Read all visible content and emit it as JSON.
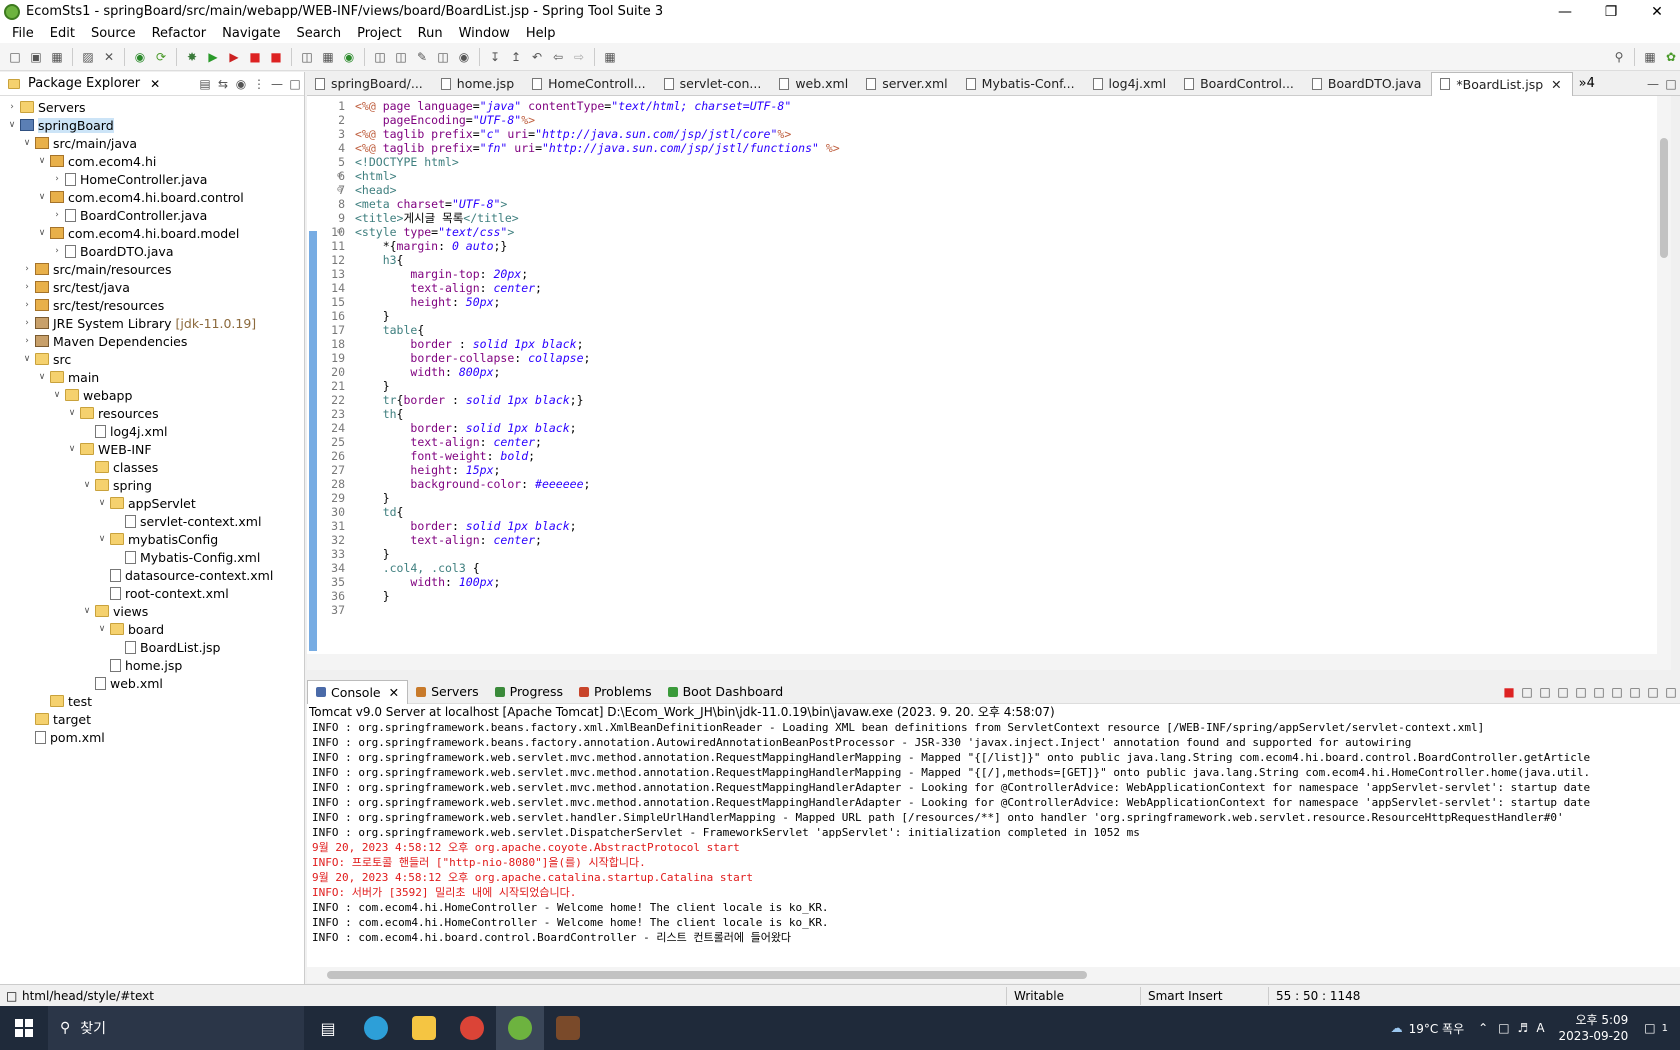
{
  "window": {
    "title": "EcomSts1 - springBoard/src/main/webapp/WEB-INF/views/board/BoardList.jsp - Spring Tool Suite 3"
  },
  "menu": [
    "File",
    "Edit",
    "Source",
    "Refactor",
    "Navigate",
    "Search",
    "Project",
    "Run",
    "Window",
    "Help"
  ],
  "explorer": {
    "title": "Package Explorer",
    "tree": [
      {
        "label": "Servers",
        "depth": 0,
        "twisty": ">",
        "icon": "folder"
      },
      {
        "label": "springBoard",
        "depth": 0,
        "twisty": "v",
        "icon": "proj",
        "selected": true
      },
      {
        "label": "src/main/java",
        "depth": 1,
        "twisty": "v",
        "icon": "pkg"
      },
      {
        "label": "com.ecom4.hi",
        "depth": 2,
        "twisty": "v",
        "icon": "pkg"
      },
      {
        "label": "HomeController.java",
        "depth": 3,
        "twisty": ">",
        "icon": "file"
      },
      {
        "label": "com.ecom4.hi.board.control",
        "depth": 2,
        "twisty": "v",
        "icon": "pkg"
      },
      {
        "label": "BoardController.java",
        "depth": 3,
        "twisty": ">",
        "icon": "file"
      },
      {
        "label": "com.ecom4.hi.board.model",
        "depth": 2,
        "twisty": "v",
        "icon": "pkg"
      },
      {
        "label": "BoardDTO.java",
        "depth": 3,
        "twisty": ">",
        "icon": "file"
      },
      {
        "label": "src/main/resources",
        "depth": 1,
        "twisty": ">",
        "icon": "pkg"
      },
      {
        "label": "src/test/java",
        "depth": 1,
        "twisty": ">",
        "icon": "pkg"
      },
      {
        "label": "src/test/resources",
        "depth": 1,
        "twisty": ">",
        "icon": "pkg"
      },
      {
        "label": "JRE System Library",
        "suffix": "[jdk-11.0.19]",
        "depth": 1,
        "twisty": ">",
        "icon": "lib"
      },
      {
        "label": "Maven Dependencies",
        "depth": 1,
        "twisty": ">",
        "icon": "lib"
      },
      {
        "label": "src",
        "depth": 1,
        "twisty": "v",
        "icon": "folder"
      },
      {
        "label": "main",
        "depth": 2,
        "twisty": "v",
        "icon": "folder"
      },
      {
        "label": "webapp",
        "depth": 3,
        "twisty": "v",
        "icon": "folder"
      },
      {
        "label": "resources",
        "depth": 4,
        "twisty": "v",
        "icon": "folder"
      },
      {
        "label": "log4j.xml",
        "depth": 5,
        "twisty": "",
        "icon": "file"
      },
      {
        "label": "WEB-INF",
        "depth": 4,
        "twisty": "v",
        "icon": "folder"
      },
      {
        "label": "classes",
        "depth": 5,
        "twisty": "",
        "icon": "folder"
      },
      {
        "label": "spring",
        "depth": 5,
        "twisty": "v",
        "icon": "folder"
      },
      {
        "label": "appServlet",
        "depth": 6,
        "twisty": "v",
        "icon": "folder"
      },
      {
        "label": "servlet-context.xml",
        "depth": 7,
        "twisty": "",
        "icon": "file"
      },
      {
        "label": "mybatisConfig",
        "depth": 6,
        "twisty": "v",
        "icon": "folder"
      },
      {
        "label": "Mybatis-Config.xml",
        "depth": 7,
        "twisty": "",
        "icon": "file"
      },
      {
        "label": "datasource-context.xml",
        "depth": 6,
        "twisty": "",
        "icon": "file"
      },
      {
        "label": "root-context.xml",
        "depth": 6,
        "twisty": "",
        "icon": "file"
      },
      {
        "label": "views",
        "depth": 5,
        "twisty": "v",
        "icon": "folder"
      },
      {
        "label": "board",
        "depth": 6,
        "twisty": "v",
        "icon": "folder"
      },
      {
        "label": "BoardList.jsp",
        "depth": 7,
        "twisty": "",
        "icon": "file"
      },
      {
        "label": "home.jsp",
        "depth": 6,
        "twisty": "",
        "icon": "file"
      },
      {
        "label": "web.xml",
        "depth": 5,
        "twisty": "",
        "icon": "file"
      },
      {
        "label": "test",
        "depth": 2,
        "twisty": "",
        "icon": "folder"
      },
      {
        "label": "target",
        "depth": 1,
        "twisty": "",
        "icon": "folder"
      },
      {
        "label": "pom.xml",
        "depth": 1,
        "twisty": "",
        "icon": "file"
      }
    ]
  },
  "editor_tabs": [
    {
      "label": "springBoard/..."
    },
    {
      "label": "home.jsp"
    },
    {
      "label": "HomeControll..."
    },
    {
      "label": "servlet-con..."
    },
    {
      "label": "web.xml"
    },
    {
      "label": "server.xml"
    },
    {
      "label": "Mybatis-Conf..."
    },
    {
      "label": "log4j.xml"
    },
    {
      "label": "BoardControl..."
    },
    {
      "label": "BoardDTO.java"
    },
    {
      "label": "*BoardList.jsp",
      "active": true
    }
  ],
  "overflow_tabs": "»4",
  "code_lines": [
    {
      "n": "1",
      "parts": [
        [
          "jsp",
          "<%@ "
        ],
        [
          "attr",
          "page "
        ],
        [
          "attr",
          "language"
        ],
        [
          "",
          "="
        ],
        [
          "val",
          "\"java\""
        ],
        [
          "",
          ""
        ],
        [
          "attr",
          " contentType"
        ],
        [
          "",
          "="
        ],
        [
          "val",
          "\"text/html; charset=UTF-8\""
        ]
      ]
    },
    {
      "n": "2",
      "parts": [
        [
          "",
          "    "
        ],
        [
          "attr",
          "pageEncoding"
        ],
        [
          "",
          "="
        ],
        [
          "val",
          "\"UTF-8\""
        ],
        [
          "jsp",
          "%>"
        ]
      ]
    },
    {
      "n": "3",
      "parts": [
        [
          "jsp",
          "<%@ "
        ],
        [
          "attr",
          "taglib "
        ],
        [
          "attr",
          "prefix"
        ],
        [
          "",
          "="
        ],
        [
          "val",
          "\"c\""
        ],
        [
          "attr",
          " uri"
        ],
        [
          "",
          "="
        ],
        [
          "val",
          "\"http://java.sun.com/jsp/jstl/core\""
        ],
        [
          "jsp",
          "%>"
        ]
      ]
    },
    {
      "n": "4",
      "parts": [
        [
          "jsp",
          "<%@ "
        ],
        [
          "attr",
          "taglib "
        ],
        [
          "attr",
          "prefix"
        ],
        [
          "",
          "="
        ],
        [
          "val",
          "\"fn\""
        ],
        [
          "attr",
          " uri"
        ],
        [
          "",
          "="
        ],
        [
          "val",
          "\"http://java.sun.com/jsp/jstl/functions\""
        ],
        [
          "jsp",
          " %>"
        ]
      ]
    },
    {
      "n": "5",
      "parts": [
        [
          "tag",
          "<!DOCTYPE html>"
        ]
      ]
    },
    {
      "n": "6",
      "fold": true,
      "parts": [
        [
          "tag",
          "<html>"
        ]
      ]
    },
    {
      "n": "7",
      "fold": true,
      "parts": [
        [
          "tag",
          "<head>"
        ]
      ]
    },
    {
      "n": "8",
      "parts": [
        [
          "tag",
          "<meta "
        ],
        [
          "attr",
          "charset"
        ],
        [
          "",
          "="
        ],
        [
          "val",
          "\"UTF-8\""
        ],
        [
          "tag",
          ">"
        ]
      ]
    },
    {
      "n": "9",
      "parts": [
        [
          "tag",
          "<title>"
        ],
        [
          "",
          "게시글 목록"
        ],
        [
          "tag",
          "</title>"
        ]
      ]
    },
    {
      "n": "10",
      "fold": true,
      "parts": [
        [
          "tag",
          "<style "
        ],
        [
          "attr",
          "type"
        ],
        [
          "",
          "="
        ],
        [
          "val",
          "\"text/css\""
        ],
        [
          "tag",
          ">"
        ]
      ]
    },
    {
      "n": "11",
      "parts": [
        [
          "",
          "    *{"
        ],
        [
          "prop",
          "margin"
        ],
        [
          "",
          ": "
        ],
        [
          "cv",
          "0 auto"
        ],
        [
          "",
          ";}"
        ]
      ]
    },
    {
      "n": "12",
      "parts": [
        [
          "sel2",
          "    h3"
        ],
        [
          "",
          "{"
        ]
      ]
    },
    {
      "n": "13",
      "parts": [
        [
          "",
          "        "
        ],
        [
          "prop",
          "margin-top"
        ],
        [
          "",
          ": "
        ],
        [
          "cv",
          "20px"
        ],
        [
          "",
          ";"
        ]
      ]
    },
    {
      "n": "14",
      "parts": [
        [
          "",
          "        "
        ],
        [
          "prop",
          "text-align"
        ],
        [
          "",
          ": "
        ],
        [
          "cv",
          "center"
        ],
        [
          "",
          ";"
        ]
      ]
    },
    {
      "n": "15",
      "parts": [
        [
          "",
          "        "
        ],
        [
          "prop",
          "height"
        ],
        [
          "",
          ": "
        ],
        [
          "cv",
          "50px"
        ],
        [
          "",
          ";"
        ]
      ]
    },
    {
      "n": "16",
      "parts": [
        [
          "",
          "    }"
        ]
      ]
    },
    {
      "n": "17",
      "parts": [
        [
          "sel2",
          "    table"
        ],
        [
          "",
          "{"
        ]
      ]
    },
    {
      "n": "18",
      "parts": [
        [
          "",
          "        "
        ],
        [
          "prop",
          "border "
        ],
        [
          "",
          ": "
        ],
        [
          "cv",
          "solid 1px black"
        ],
        [
          "",
          ";"
        ]
      ]
    },
    {
      "n": "19",
      "parts": [
        [
          "",
          "        "
        ],
        [
          "prop",
          "border-collapse"
        ],
        [
          "",
          ": "
        ],
        [
          "cv",
          "collapse"
        ],
        [
          "",
          ";"
        ]
      ]
    },
    {
      "n": "20",
      "parts": [
        [
          "",
          "        "
        ],
        [
          "prop",
          "width"
        ],
        [
          "",
          ": "
        ],
        [
          "cv",
          "800px"
        ],
        [
          "",
          ";"
        ]
      ]
    },
    {
      "n": "21",
      "parts": [
        [
          "",
          "    }"
        ]
      ]
    },
    {
      "n": "22",
      "parts": [
        [
          "sel2",
          "    tr"
        ],
        [
          "",
          "{"
        ],
        [
          "prop",
          "border "
        ],
        [
          "",
          ": "
        ],
        [
          "cv",
          "solid 1px black"
        ],
        [
          "",
          ";}"
        ]
      ]
    },
    {
      "n": "23",
      "parts": [
        [
          "sel2",
          "    th"
        ],
        [
          "",
          "{"
        ]
      ]
    },
    {
      "n": "24",
      "parts": [
        [
          "",
          "        "
        ],
        [
          "prop",
          "border"
        ],
        [
          "",
          ": "
        ],
        [
          "cv",
          "solid 1px black"
        ],
        [
          "",
          ";"
        ]
      ]
    },
    {
      "n": "25",
      "parts": [
        [
          "",
          "        "
        ],
        [
          "prop",
          "text-align"
        ],
        [
          "",
          ": "
        ],
        [
          "cv",
          "center"
        ],
        [
          "",
          ";"
        ]
      ]
    },
    {
      "n": "26",
      "parts": [
        [
          "",
          "        "
        ],
        [
          "prop",
          "font-weight"
        ],
        [
          "",
          ": "
        ],
        [
          "cv",
          "bold"
        ],
        [
          "",
          ";"
        ]
      ]
    },
    {
      "n": "27",
      "parts": [
        [
          "",
          "        "
        ],
        [
          "prop",
          "height"
        ],
        [
          "",
          ": "
        ],
        [
          "cv",
          "15px"
        ],
        [
          "",
          ";"
        ]
      ]
    },
    {
      "n": "28",
      "parts": [
        [
          "",
          "        "
        ],
        [
          "prop",
          "background-color"
        ],
        [
          "",
          ": "
        ],
        [
          "cv",
          "#eeeeee"
        ],
        [
          "",
          ";"
        ]
      ]
    },
    {
      "n": "29",
      "parts": [
        [
          "",
          "    }"
        ]
      ]
    },
    {
      "n": "30",
      "parts": [
        [
          "sel2",
          "    td"
        ],
        [
          "",
          "{"
        ]
      ]
    },
    {
      "n": "31",
      "parts": [
        [
          "",
          "        "
        ],
        [
          "prop",
          "border"
        ],
        [
          "",
          ": "
        ],
        [
          "cv",
          "solid 1px black"
        ],
        [
          "",
          ";"
        ]
      ]
    },
    {
      "n": "32",
      "parts": [
        [
          "",
          "        "
        ],
        [
          "prop",
          "text-align"
        ],
        [
          "",
          ": "
        ],
        [
          "cv",
          "center"
        ],
        [
          "",
          ";"
        ]
      ]
    },
    {
      "n": "33",
      "parts": [
        [
          "",
          "    }"
        ]
      ]
    },
    {
      "n": "34",
      "parts": [
        [
          "sel2",
          "    .col4, .col3 "
        ],
        [
          "",
          "{"
        ]
      ]
    },
    {
      "n": "35",
      "parts": [
        [
          "",
          "        "
        ],
        [
          "prop",
          "width"
        ],
        [
          "",
          ": "
        ],
        [
          "cv",
          "100px"
        ],
        [
          "",
          ";"
        ]
      ]
    },
    {
      "n": "36",
      "parts": [
        [
          "",
          "    }"
        ]
      ]
    },
    {
      "n": "37",
      "parts": [
        [
          "",
          ""
        ]
      ]
    }
  ],
  "console_tabs": [
    {
      "label": "Console",
      "active": true,
      "color": "#4a6aa8"
    },
    {
      "label": "Servers",
      "color": "#c87a2a"
    },
    {
      "label": "Progress",
      "color": "#3a8a3a"
    },
    {
      "label": "Problems",
      "color": "#c8442a"
    },
    {
      "label": "Boot Dashboard",
      "color": "#3a9a3a"
    }
  ],
  "console_header": "Tomcat v9.0 Server at localhost [Apache Tomcat] D:\\Ecom_Work_JH\\bin\\jdk-11.0.19\\bin\\javaw.exe  (2023. 9. 20. 오후 4:58:07)",
  "console_lines": [
    {
      "text": "INFO : org.springframework.beans.factory.xml.XmlBeanDefinitionReader - Loading XML bean definitions from ServletContext resource [/WEB-INF/spring/appServlet/servlet-context.xml]",
      "red": false
    },
    {
      "text": "INFO : org.springframework.beans.factory.annotation.AutowiredAnnotationBeanPostProcessor - JSR-330 'javax.inject.Inject' annotation found and supported for autowiring",
      "red": false
    },
    {
      "text": "INFO : org.springframework.web.servlet.mvc.method.annotation.RequestMappingHandlerMapping - Mapped \"{[/list]}\" onto public java.lang.String com.ecom4.hi.board.control.BoardController.getArticle",
      "red": false
    },
    {
      "text": "INFO : org.springframework.web.servlet.mvc.method.annotation.RequestMappingHandlerMapping - Mapped \"{[/],methods=[GET]}\" onto public java.lang.String com.ecom4.hi.HomeController.home(java.util.",
      "red": false
    },
    {
      "text": "INFO : org.springframework.web.servlet.mvc.method.annotation.RequestMappingHandlerAdapter - Looking for @ControllerAdvice: WebApplicationContext for namespace 'appServlet-servlet': startup date",
      "red": false
    },
    {
      "text": "INFO : org.springframework.web.servlet.mvc.method.annotation.RequestMappingHandlerAdapter - Looking for @ControllerAdvice: WebApplicationContext for namespace 'appServlet-servlet': startup date",
      "red": false
    },
    {
      "text": "INFO : org.springframework.web.servlet.handler.SimpleUrlHandlerMapping - Mapped URL path [/resources/**] onto handler 'org.springframework.web.servlet.resource.ResourceHttpRequestHandler#0'",
      "red": false
    },
    {
      "text": "INFO : org.springframework.web.servlet.DispatcherServlet - FrameworkServlet 'appServlet': initialization completed in 1052 ms",
      "red": false
    },
    {
      "text": "9월 20, 2023 4:58:12 오후 org.apache.coyote.AbstractProtocol start",
      "red": true
    },
    {
      "text": "INFO: 프로토콜 핸들러 [\"http-nio-8080\"]을(를) 시작합니다.",
      "red": true
    },
    {
      "text": "9월 20, 2023 4:58:12 오후 org.apache.catalina.startup.Catalina start",
      "red": true
    },
    {
      "text": "INFO: 서버가 [3592] 밀리초 내에 시작되었습니다.",
      "red": true
    },
    {
      "text": "INFO : com.ecom4.hi.HomeController - Welcome home! The client locale is ko_KR.",
      "red": false
    },
    {
      "text": "INFO : com.ecom4.hi.HomeController - Welcome home! The client locale is ko_KR.",
      "red": false
    },
    {
      "text": "INFO : com.ecom4.hi.board.control.BoardController - 리스트 컨트롤러에 들어왔다",
      "red": false
    }
  ],
  "status": {
    "path": "html/head/style/#text",
    "writable": "Writable",
    "insert_mode": "Smart Insert",
    "position": "55 : 50 : 1148"
  },
  "taskbar": {
    "search_placeholder": "찾기",
    "weather": "19°C  폭우",
    "time": "오후 5:09",
    "date": "2023-09-20",
    "notifications": "1",
    "ime": "A"
  }
}
